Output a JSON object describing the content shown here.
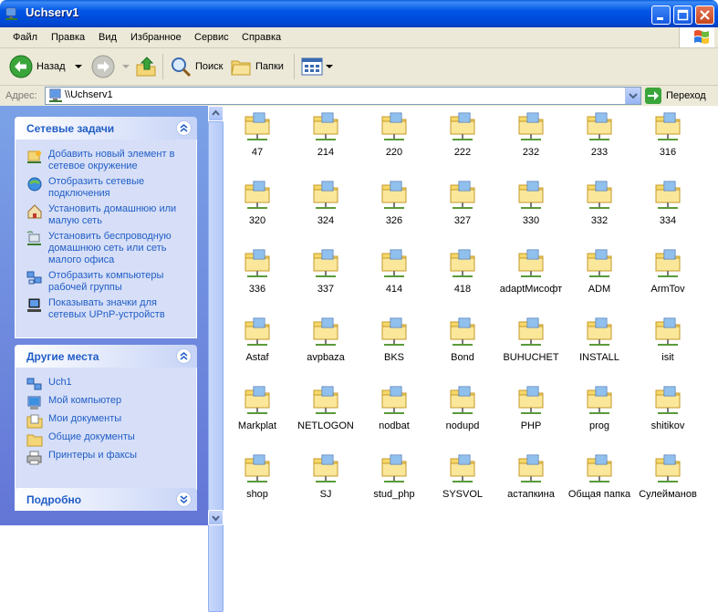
{
  "window": {
    "title": "Uchserv1"
  },
  "menu": [
    "Файл",
    "Правка",
    "Вид",
    "Избранное",
    "Сервис",
    "Справка"
  ],
  "toolbar": {
    "back": "Назад",
    "search": "Поиск",
    "folders": "Папки"
  },
  "address": {
    "label": "Адрес:",
    "value": "\\\\Uchserv1",
    "go": "Переход"
  },
  "panels": {
    "network_tasks": {
      "title": "Сетевые задачи",
      "items": [
        {
          "label": "Добавить новый элемент в сетевое окружение",
          "icon": "add-network-place-icon"
        },
        {
          "label": "Отобразить сетевые подключения",
          "icon": "network-connections-icon"
        },
        {
          "label": "Установить домашнюю или малую сеть",
          "icon": "home-network-icon"
        },
        {
          "label": "Установить беспроводную домашнюю сеть или сеть малого офиса",
          "icon": "wireless-network-icon"
        },
        {
          "label": "Отобразить компьютеры рабочей группы",
          "icon": "workgroup-computers-icon"
        },
        {
          "label": "Показывать значки для сетевых UPnP-устройств",
          "icon": "upnp-devices-icon"
        }
      ]
    },
    "other_places": {
      "title": "Другие места",
      "items": [
        {
          "label": "Uch1",
          "icon": "workgroup-icon"
        },
        {
          "label": "Мой компьютер",
          "icon": "my-computer-icon"
        },
        {
          "label": "Мои документы",
          "icon": "my-documents-icon"
        },
        {
          "label": "Общие документы",
          "icon": "shared-documents-icon"
        },
        {
          "label": "Принтеры и факсы",
          "icon": "printers-icon"
        }
      ]
    },
    "details": {
      "title": "Подробно"
    }
  },
  "shares": [
    "47",
    "214",
    "220",
    "222",
    "232",
    "233",
    "316",
    "320",
    "324",
    "326",
    "327",
    "330",
    "332",
    "334",
    "336",
    "337",
    "414",
    "418",
    "adaptМисофт",
    "ADM",
    "ArmTov",
    "Astaf",
    "avpbaza",
    "BKS",
    "Bond",
    "BUHUCHET",
    "INSTALL",
    "isit",
    "Markplat",
    "NETLOGON",
    "nodbat",
    "nodupd",
    "PHP",
    "prog",
    "shitikov",
    "shop",
    "SJ",
    "stud_php",
    "SYSVOL",
    "астапкина",
    "Общая папка",
    "Сулейманов"
  ]
}
